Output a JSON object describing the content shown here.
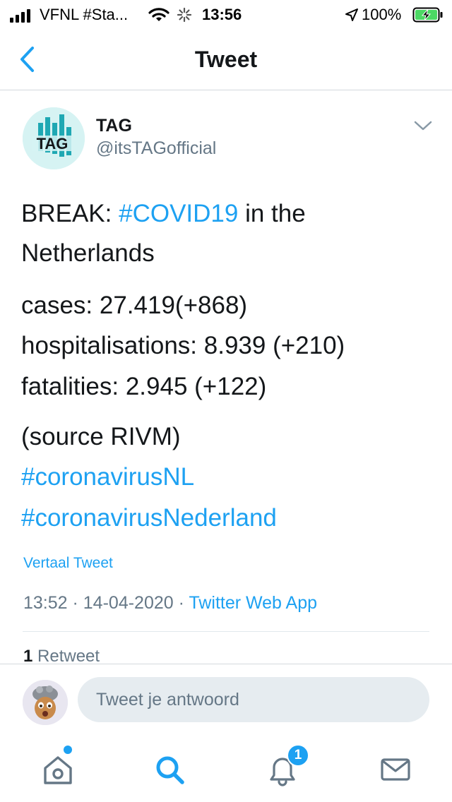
{
  "status_bar": {
    "carrier": "VFNL #Sta...",
    "time": "13:56",
    "battery_percent": "100%",
    "battery_level": 1.0
  },
  "nav": {
    "title": "Tweet"
  },
  "tweet": {
    "author_name": "TAG",
    "author_handle": "@itsTAGofficial",
    "avatar_text": "TAG",
    "text_prefix": "BREAK: ",
    "hashtag_covid": "#COVID19",
    "text_suffix": " in the",
    "text_line2": "Netherlands",
    "cases": "cases: 27.419(+868)",
    "hospitalisations": "hospitalisations: 8.939 (+210)",
    "fatalities": "fatalities: 2.945 (+122)",
    "source": "(source RIVM)",
    "hashtag_nl": "#coronavirusNL",
    "hashtag_nederland": "#coronavirusNederland",
    "translate_label": "Vertaal Tweet",
    "timestamp": "13:52 · 14-04-2020 · ",
    "client": "Twitter Web App",
    "retweet_count": "1",
    "retweet_label": " Retweet"
  },
  "reply": {
    "placeholder": "Tweet je antwoord"
  },
  "tab_bar": {
    "notification_count": "1"
  },
  "colors": {
    "accent": "#1da1f2",
    "text": "#14171a",
    "secondary": "#657786",
    "brand_teal": "#1fa8b3",
    "battery_green": "#4cd964"
  }
}
